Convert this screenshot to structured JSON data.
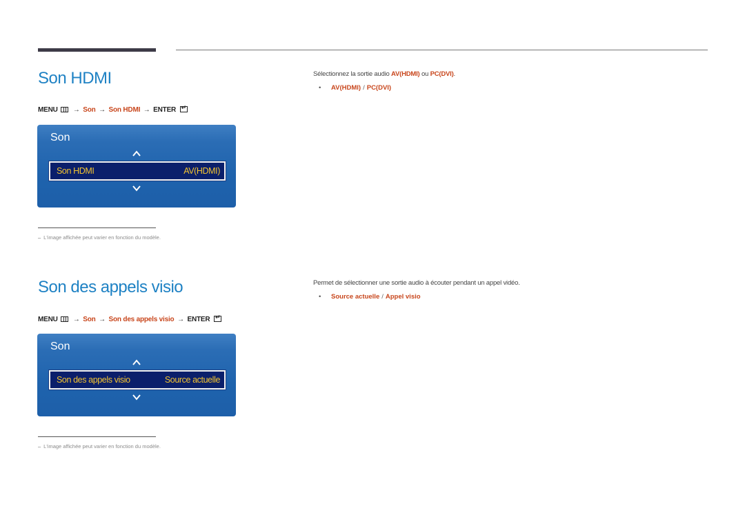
{
  "header": {
    "decorative_rules": true
  },
  "sections": [
    {
      "title": "Son HDMI",
      "menu_path": {
        "menu_label": "MENU",
        "menu_icon": "menu-grid-icon",
        "arrow": "→",
        "steps": [
          "Son",
          "Son HDMI"
        ],
        "enter_label": "ENTER",
        "enter_icon": "enter-icon"
      },
      "osd": {
        "title": "Son",
        "up_icon": "chevron-up-icon",
        "down_icon": "chevron-down-icon",
        "selected_item": {
          "label": "Son HDMI",
          "value": "AV(HDMI)"
        }
      },
      "note": {
        "dash": "–",
        "text": "L'image affichée peut varier en fonction du modèle."
      },
      "description": {
        "prefix": "Sélectionnez la sortie audio ",
        "option_a": "AV(HDMI)",
        "middle": " ou ",
        "option_b": "PC(DVI)",
        "suffix": "."
      },
      "options": {
        "bullet": "•",
        "items": [
          "AV(HDMI)",
          "PC(DVI)"
        ],
        "separator": "/"
      }
    },
    {
      "title": "Son des appels visio",
      "menu_path": {
        "menu_label": "MENU",
        "menu_icon": "menu-grid-icon",
        "arrow": "→",
        "steps": [
          "Son",
          "Son des appels visio"
        ],
        "enter_label": "ENTER",
        "enter_icon": "enter-icon"
      },
      "osd": {
        "title": "Son",
        "up_icon": "chevron-up-icon",
        "down_icon": "chevron-down-icon",
        "selected_item": {
          "label": "Son des appels visio",
          "value": "Source actuelle"
        }
      },
      "note": {
        "dash": "–",
        "text": "L'image affichée peut varier en fonction du modèle."
      },
      "description": {
        "text": "Permet de sélectionner une sortie audio à écouter pendant un appel vidéo."
      },
      "options": {
        "bullet": "•",
        "items": [
          "Source actuelle",
          "Appel visio"
        ],
        "separator": "/"
      }
    }
  ],
  "colors": {
    "title_blue": "#1f82c4",
    "highlight_orange": "#c8461c",
    "osd_blue": "#1f63ad",
    "osd_row_navy": "#0b1f6b",
    "osd_text_yellow": "#f4c430"
  }
}
